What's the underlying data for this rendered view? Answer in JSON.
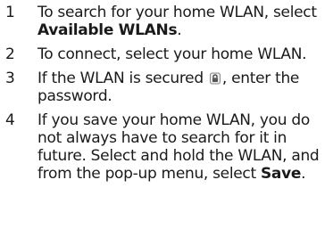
{
  "steps": [
    {
      "number": "1",
      "before": "To search for your home WLAN, select ",
      "strong": "Available WLANs",
      "after": "."
    },
    {
      "number": "2",
      "text": "To connect, select your home WLAN."
    },
    {
      "number": "3",
      "before": "If the WLAN is secured ",
      "icon": "lock-icon",
      "after": ", enter the password."
    },
    {
      "number": "4",
      "before": "If you save your home WLAN, you do not always have to search for it in future. Select and hold the WLAN, and from the pop-up menu, select ",
      "strong": "Save",
      "after": "."
    }
  ]
}
